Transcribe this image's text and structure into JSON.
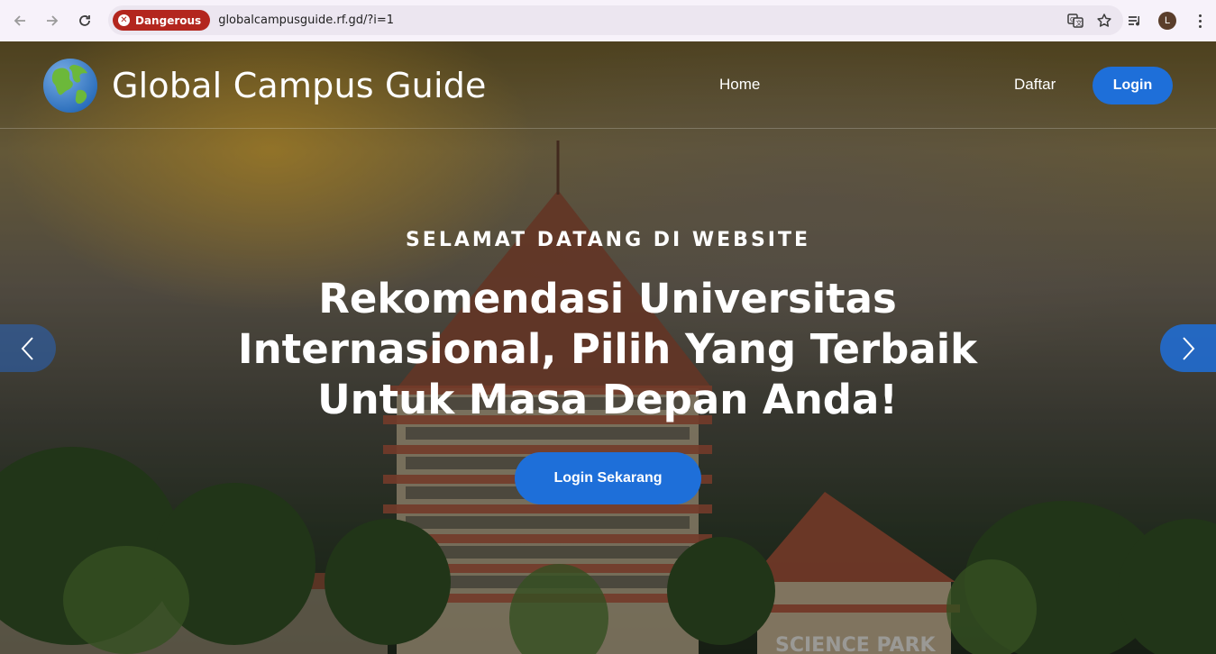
{
  "browser": {
    "security_label": "Dangerous",
    "url": "globalcampusguide.rf.gd/?i=1",
    "profile_initial": "L"
  },
  "site": {
    "brand_name": "Global Campus Guide",
    "nav": {
      "home": "Home",
      "daftar": "Daftar",
      "login": "Login"
    }
  },
  "hero": {
    "subtitle": "SELAMAT DATANG DI WEBSITE",
    "headline": "Rekomendasi Universitas Internasional, Pilih Yang Terbaik Untuk Masa Depan Anda!",
    "cta": "Login Sekarang",
    "sign_text": "SCIENCE PARK"
  },
  "colors": {
    "accent": "#1e6fd9",
    "danger": "#b3261e"
  }
}
